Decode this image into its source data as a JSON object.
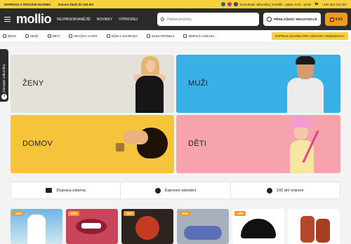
{
  "topbar": {
    "shipping": "DOPRAVA A VRÁCENÍ ZDARMA",
    "returns": "Vrácení zboží do 100 dní",
    "consult": "Konzultujte odborníka | Pondělí - pátek: 6:00 - 16:00",
    "phone": "+420 228 222 397"
  },
  "header": {
    "logo": "mollio",
    "nav": [
      "NEJPRODÁVANĚJŠÍ",
      "NOVINKY",
      "VÝPRODEJ"
    ],
    "search_placeholder": "Hledat produkty",
    "login": "PŘIHLÁŠENÍ / REGISTRACE",
    "cart": "0 Kč"
  },
  "categories": [
    "ŽENY",
    "MUŽI",
    "DĚTI",
    "HRAČKY A HRY",
    "DŮM A ZAHRADA",
    "ELEKTRONIKA",
    "ZDRAVÍ A KRÁSA"
  ],
  "promo_pill": "DOPRAVA ZDARMA PRO VŠECHNY OBJEDNÁVKY",
  "sidetab": {
    "text": "Otestujte odborníka",
    "icon": "?"
  },
  "tiles": {
    "zeny": "ŽENY",
    "muzi": "MUŽI",
    "domov": "DOMOV",
    "deti": "DĚTI"
  },
  "features": [
    "Doprava zdarma",
    "Expresní odeslání",
    "100 dní vrácení"
  ],
  "products": [
    {
      "badge": "-45%"
    },
    {
      "badge": "-67%"
    },
    {
      "badge": "-39%"
    },
    {
      "badge": "-51%"
    },
    {
      "badge": "-33%"
    },
    {
      "badge": ""
    }
  ],
  "colors": {
    "accent_yellow": "#f7d23e",
    "header_dark": "#2b2b2b",
    "cart_orange": "#f39a1e",
    "tile_men": "#38b1e6",
    "tile_home": "#f6c43b",
    "tile_kids": "#f6a3ad"
  }
}
